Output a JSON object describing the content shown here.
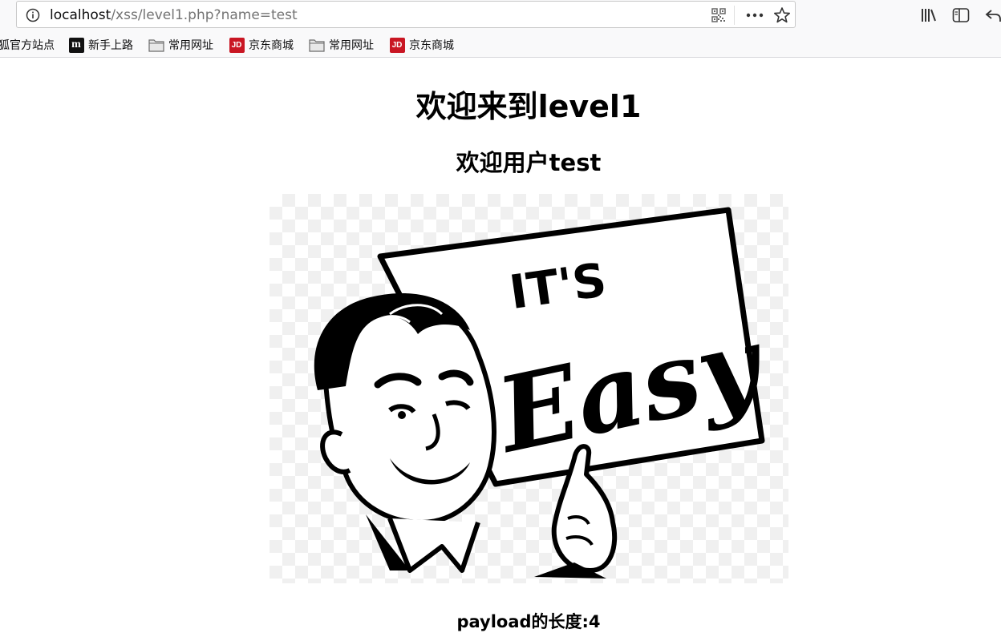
{
  "browser": {
    "url_host": "localhost",
    "url_path": "/xss/level1.php?name=test"
  },
  "bookmarks": [
    {
      "label": "狐官方站点",
      "icon": "none"
    },
    {
      "label": "新手上路",
      "icon": "m-logo-icon"
    },
    {
      "label": "常用网址",
      "icon": "folder-icon"
    },
    {
      "label": "京东商城",
      "icon": "jd-logo-icon"
    },
    {
      "label": "常用网址",
      "icon": "folder-icon"
    },
    {
      "label": "京东商城",
      "icon": "jd-logo-icon"
    }
  ],
  "page": {
    "title": "欢迎来到level1",
    "welcome": "欢迎用户test",
    "payload_length": "payload的长度:4",
    "image": {
      "sign_line1": "IT'S",
      "sign_line2": "Easy"
    }
  }
}
